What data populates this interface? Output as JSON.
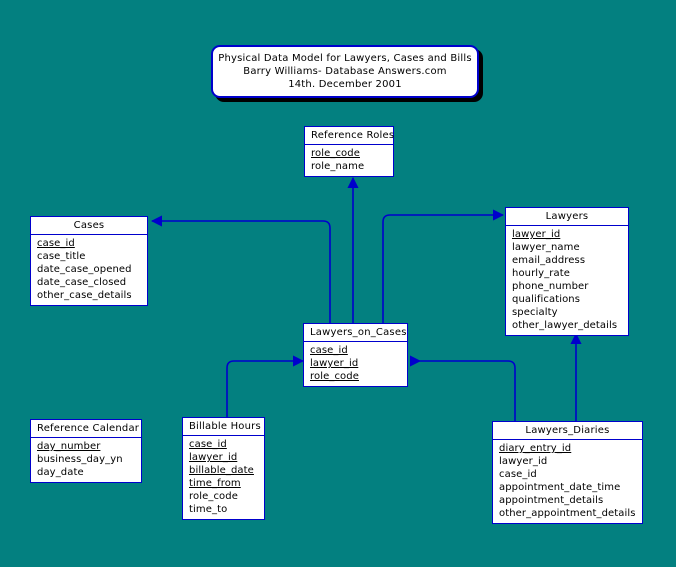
{
  "diagram": {
    "background_color": "#038080",
    "line_color": "#0000cc",
    "box_fill": "#ffffff",
    "title": {
      "line1": "Physical Data Model for Lawyers, Cases and Bills",
      "line2": "Barry Williams- Database Answers.com",
      "line3": "14th. December 2001"
    },
    "entities": [
      {
        "id": "reference_roles",
        "name": "Reference Roles",
        "attributes": [
          {
            "name": "role_code",
            "key": true
          },
          {
            "name": "role_name",
            "key": false
          }
        ]
      },
      {
        "id": "cases",
        "name": "Cases",
        "attributes": [
          {
            "name": "case_id",
            "key": true
          },
          {
            "name": "case_title",
            "key": false
          },
          {
            "name": "date_case_opened",
            "key": false
          },
          {
            "name": "date_case_closed",
            "key": false
          },
          {
            "name": "other_case_details",
            "key": false
          }
        ]
      },
      {
        "id": "lawyers",
        "name": "Lawyers",
        "attributes": [
          {
            "name": "lawyer_id",
            "key": true
          },
          {
            "name": "lawyer_name",
            "key": false
          },
          {
            "name": "email_address",
            "key": false
          },
          {
            "name": "hourly_rate",
            "key": false
          },
          {
            "name": "phone_number",
            "key": false
          },
          {
            "name": "qualifications",
            "key": false
          },
          {
            "name": "specialty",
            "key": false
          },
          {
            "name": "other_lawyer_details",
            "key": false
          }
        ]
      },
      {
        "id": "lawyers_on_cases",
        "name": "Lawyers_on_Cases",
        "attributes": [
          {
            "name": "case_id",
            "key": true
          },
          {
            "name": "lawyer_id",
            "key": true
          },
          {
            "name": "role_code",
            "key": true
          }
        ]
      },
      {
        "id": "reference_calendar",
        "name": "Reference Calendar",
        "attributes": [
          {
            "name": "day_number",
            "key": true
          },
          {
            "name": "business_day_yn",
            "key": false
          },
          {
            "name": "day_date",
            "key": false
          }
        ]
      },
      {
        "id": "billable_hours",
        "name": "Billable Hours",
        "attributes": [
          {
            "name": "case_id",
            "key": true
          },
          {
            "name": "lawyer_id",
            "key": true
          },
          {
            "name": "billable_date",
            "key": true
          },
          {
            "name": "time_from",
            "key": true
          },
          {
            "name": "role_code",
            "key": false
          },
          {
            "name": "time_to",
            "key": false
          }
        ]
      },
      {
        "id": "lawyers_diaries",
        "name": "Lawyers_Diaries",
        "attributes": [
          {
            "name": "diary_entry_id",
            "key": true
          },
          {
            "name": "lawyer_id",
            "key": false
          },
          {
            "name": "case_id",
            "key": false
          },
          {
            "name": "appointment_date_time",
            "key": false
          },
          {
            "name": "appointment_details",
            "key": false
          },
          {
            "name": "other_appointment_details",
            "key": false
          }
        ]
      }
    ],
    "relationships": [
      {
        "from": "lawyers_on_cases",
        "to": "cases",
        "arrow": "left"
      },
      {
        "from": "lawyers_on_cases",
        "to": "lawyers",
        "arrow": "right"
      },
      {
        "from": "lawyers_on_cases",
        "to": "reference_roles",
        "arrow": "up"
      },
      {
        "from": "billable_hours",
        "to": "lawyers_on_cases",
        "arrow": "right"
      },
      {
        "from": "lawyers_diaries",
        "to": "lawyers_on_cases",
        "arrow": "left"
      },
      {
        "from": "lawyers_diaries",
        "to": "lawyers",
        "arrow": "up"
      }
    ]
  }
}
